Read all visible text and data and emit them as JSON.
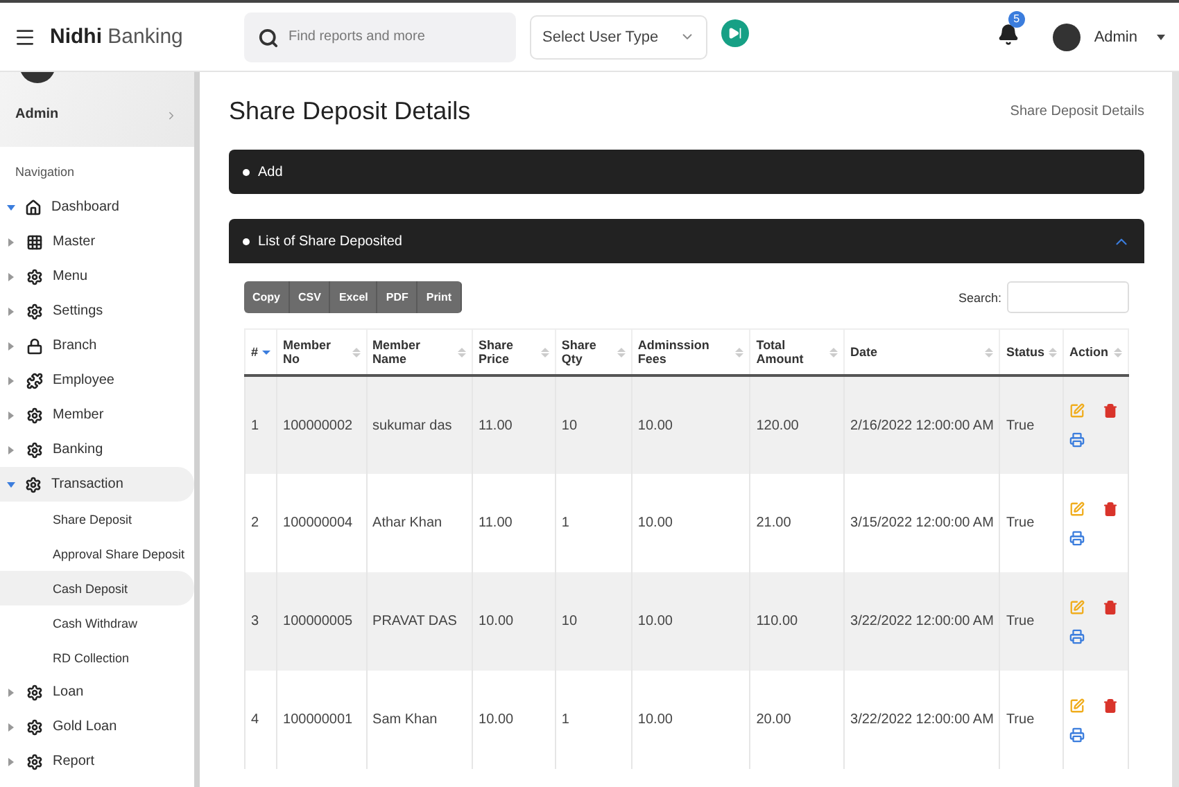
{
  "topbar": {
    "brand": "**Nidhi** Banking",
    "search": {
      "placeholder": "Find reports and more"
    },
    "user_type_select": {
      "value": "Select User Type"
    },
    "notifications": {
      "count": "5"
    },
    "user": {
      "name": "Admin"
    }
  },
  "sidebar": {
    "profile_name": "Admin",
    "section_label": "Navigation",
    "items": [
      {
        "label": "Dashboard",
        "expanded": true,
        "selected": false
      },
      {
        "label": "Master",
        "expanded": false,
        "selected": false
      },
      {
        "label": "Menu",
        "expanded": false,
        "selected": false
      },
      {
        "label": "Settings",
        "expanded": false,
        "selected": false
      },
      {
        "label": "Branch",
        "expanded": false,
        "selected": false
      },
      {
        "label": "Employee",
        "expanded": false,
        "selected": false
      },
      {
        "label": "Member",
        "expanded": false,
        "selected": false
      },
      {
        "label": "Banking",
        "expanded": false,
        "selected": false
      },
      {
        "label": "Transaction",
        "expanded": true,
        "selected": true,
        "children": [
          {
            "label": "Share Deposit",
            "selected": false
          },
          {
            "label": "Approval Share Deposit",
            "selected": false
          },
          {
            "label": "Cash Deposit",
            "selected": true
          },
          {
            "label": "Cash Withdraw",
            "selected": false
          },
          {
            "label": "RD Collection",
            "selected": false
          }
        ]
      },
      {
        "label": "Loan",
        "expanded": false,
        "selected": false
      },
      {
        "label": "Gold Loan",
        "expanded": false,
        "selected": false
      },
      {
        "label": "Report",
        "expanded": false,
        "selected": false
      }
    ]
  },
  "page": {
    "title": "Share Deposit Details",
    "breadcrumb": "Share Deposit Details"
  },
  "add_panel": {
    "title": "Add"
  },
  "list_panel": {
    "title": "List of Share Deposited",
    "expanded": true,
    "export_buttons": [
      "Copy",
      "CSV",
      "Excel",
      "PDF",
      "Print"
    ],
    "search_label": "Search:",
    "columns": [
      {
        "label": "#",
        "sorted": true
      },
      {
        "label": "Member No",
        "sorted": false
      },
      {
        "label": "Member Name",
        "sorted": false
      },
      {
        "label": "Share Price",
        "sorted": false
      },
      {
        "label": "Share Qty",
        "sorted": false
      },
      {
        "label": "Adminssion Fees",
        "sorted": false
      },
      {
        "label": "Total Amount",
        "sorted": false
      },
      {
        "label": "Date",
        "sorted": false
      },
      {
        "label": "Status",
        "sorted": false
      },
      {
        "label": "Action",
        "sorted": false
      }
    ],
    "rows": [
      [
        "1",
        "100000002",
        "sukumar das",
        "11.00",
        "10",
        "10.00",
        "120.00",
        "2/16/2022 12:00:00 AM",
        "True"
      ],
      [
        "2",
        "100000004",
        "Athar Khan",
        "11.00",
        "1",
        "10.00",
        "21.00",
        "3/15/2022 12:00:00 AM",
        "True"
      ],
      [
        "3",
        "100000005",
        "PRAVAT DAS",
        "10.00",
        "10",
        "10.00",
        "110.00",
        "3/22/2022 12:00:00 AM",
        "True"
      ],
      [
        "4",
        "100000001",
        "Sam Khan",
        "10.00",
        "1",
        "10.00",
        "20.00",
        "3/22/2022 12:00:00 AM",
        "True"
      ]
    ]
  }
}
